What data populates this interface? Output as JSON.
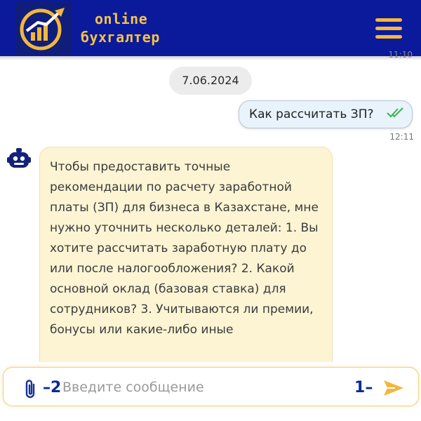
{
  "header": {
    "brand_line1": "online",
    "brand_line2": "бухгалтер",
    "logo_icon": "growth-chart-logo-icon",
    "menu_icon": "hamburger-menu-icon",
    "colors": {
      "background": "#0b1a9a",
      "accent": "#f4b73a"
    }
  },
  "chat": {
    "clipped_time": "11:10",
    "date_divider": "7.06.2024",
    "user_message": {
      "text": "Как рассчитать ЗП?",
      "time": "12:11",
      "status_icon": "double-check-icon"
    },
    "bot_message": {
      "avatar_icon": "robot-icon",
      "text": "Чтобы предоставить точные рекомендации по расчету заработной платы (ЗП) для бизнеса в Казахстане, мне нужно уточнить несколько деталей: 1. Вы хотите рассчитать заработную плату до или после налогообложения? 2. Какой основной оклад (базовая ставка) для сотрудников? 3. Учитываются ли премии, бонусы или какие-либо иные"
    }
  },
  "composer": {
    "placeholder": "Введите сообщение",
    "attach_icon": "paperclip-icon",
    "send_icon": "send-icon",
    "marker_attach": "2",
    "marker_send": "1"
  }
}
